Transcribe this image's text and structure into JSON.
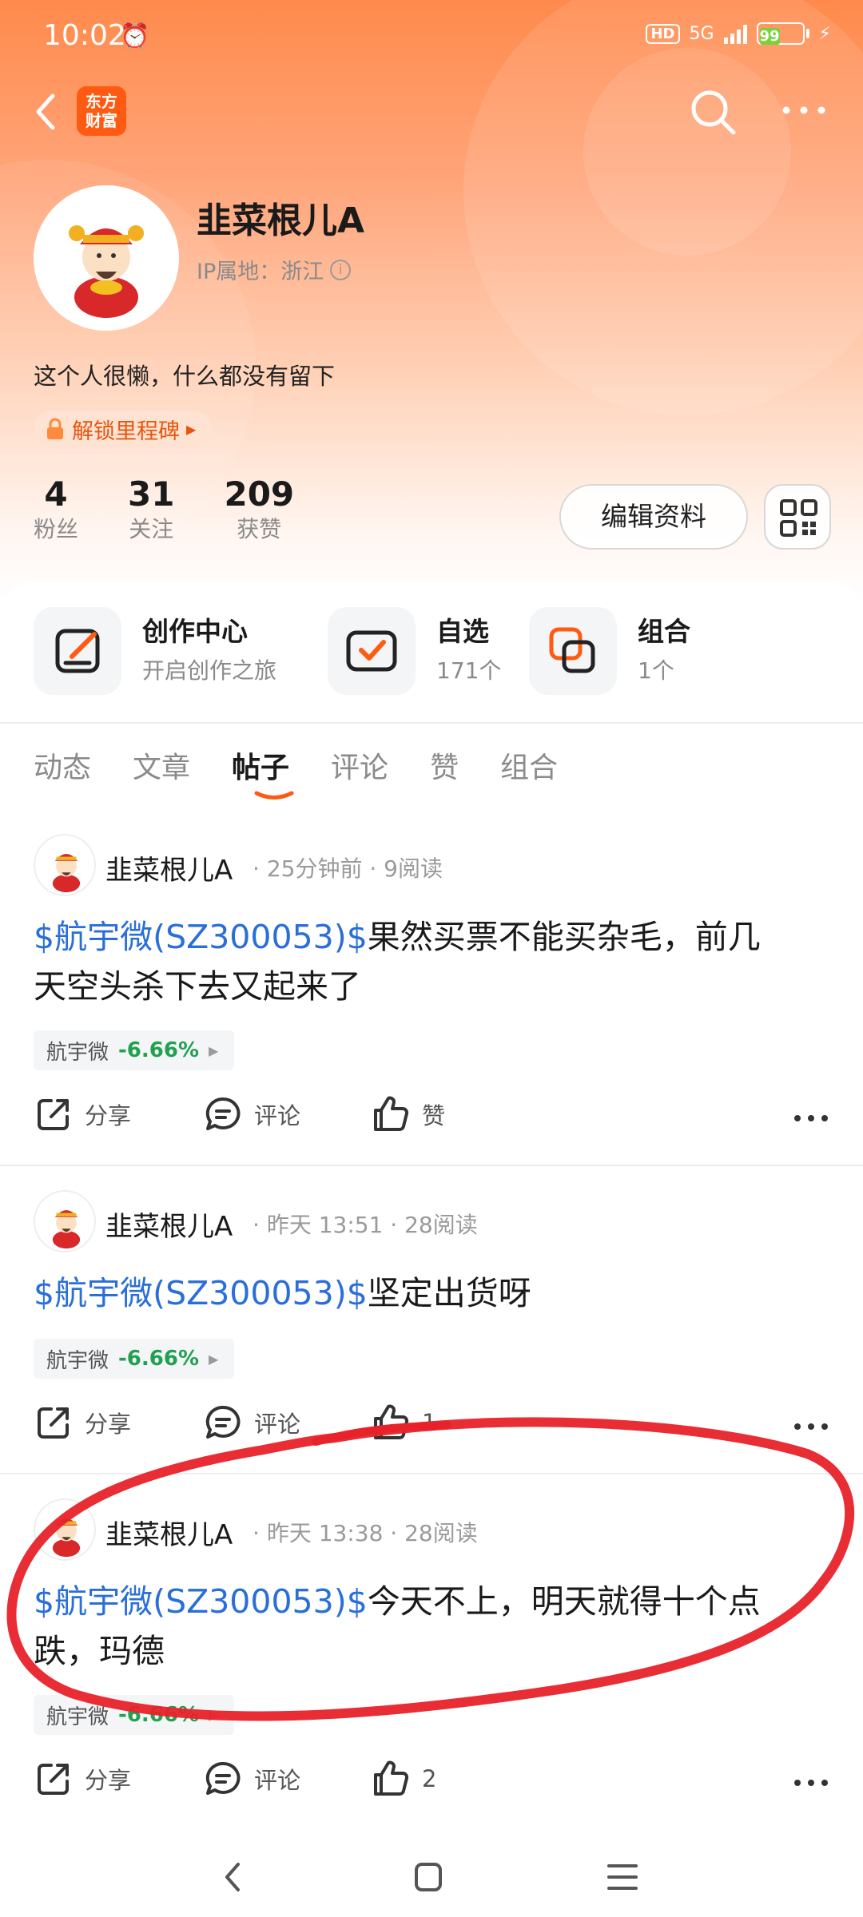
{
  "status_bar": {
    "time": "10:02",
    "network": "5G",
    "hd": "HD",
    "battery": "99"
  },
  "header": {
    "brand_line1": "东方",
    "brand_line2": "财富"
  },
  "profile": {
    "username": "韭菜根儿A",
    "ip_location": "IP属地：浙江",
    "bio": "这个人很懒，什么都没有留下",
    "milestone": "解锁里程碑",
    "stats": [
      {
        "value": "4",
        "label": "粉丝"
      },
      {
        "value": "31",
        "label": "关注"
      },
      {
        "value": "209",
        "label": "获赞"
      }
    ],
    "edit_label": "编辑资料"
  },
  "quick_links": [
    {
      "title": "创作中心",
      "sub": "开启创作之旅"
    },
    {
      "title": "自选",
      "sub": "171个"
    },
    {
      "title": "组合",
      "sub": "1个"
    }
  ],
  "tabs": [
    "动态",
    "文章",
    "帖子",
    "评论",
    "赞",
    "组合"
  ],
  "active_tab": "帖子",
  "posts": [
    {
      "author": "韭菜根儿A",
      "time": "25分钟前",
      "reads": "9阅读",
      "stock_tag": "$航宇微(SZ300053)$",
      "text_line1": "果然买票不能买杂毛，前几",
      "text_line2": "天空头杀下去又起来了",
      "chip_name": "航宇微",
      "chip_change": "-6.66%",
      "share": "分享",
      "comment": "评论",
      "like": "赞"
    },
    {
      "author": "韭菜根儿A",
      "time": "昨天 13:51",
      "reads": "28阅读",
      "stock_tag": "$航宇微(SZ300053)$",
      "text_line1": "坚定出货呀",
      "text_line2": "",
      "chip_name": "航宇微",
      "chip_change": "-6.66%",
      "share": "分享",
      "comment": "评论",
      "like": "1"
    },
    {
      "author": "韭菜根儿A",
      "time": "昨天 13:38",
      "reads": "28阅读",
      "stock_tag": "$航宇微(SZ300053)$",
      "text_line1": "今天不上，明天就得十个点",
      "text_line2": "跌，玛德",
      "chip_name": "航宇微",
      "chip_change": "-6.66%",
      "share": "分享",
      "comment": "评论",
      "like": "2"
    }
  ],
  "colors": {
    "accent": "#ff5a12",
    "stock_link": "#2a6fd8",
    "down": "#20a050",
    "annotation": "#e8222a"
  }
}
